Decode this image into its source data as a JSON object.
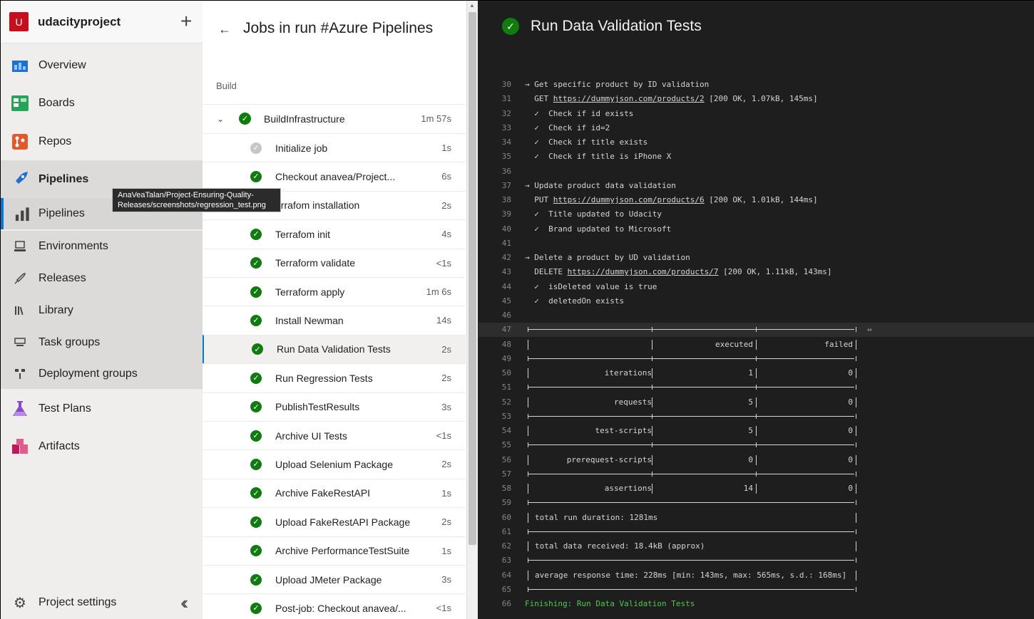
{
  "nav": {
    "org_initial": "U",
    "org_name": "udacityproject",
    "items": [
      {
        "label": "Overview"
      },
      {
        "label": "Boards"
      },
      {
        "label": "Repos"
      },
      {
        "label": "Pipelines"
      },
      {
        "label": "Pipelines"
      },
      {
        "label": "Environments"
      },
      {
        "label": "Releases"
      },
      {
        "label": "Library"
      },
      {
        "label": "Task groups"
      },
      {
        "label": "Deployment groups"
      },
      {
        "label": "Test Plans"
      },
      {
        "label": "Artifacts"
      }
    ],
    "project_settings": "Project settings",
    "tooltip_line1": "AnaVeaTalan/Project-Ensuring-Quality-",
    "tooltip_line2": "Releases/screenshots/regression_test.png"
  },
  "jobs": {
    "title": "Jobs in run #Azure Pipelines",
    "stage": "Build",
    "parent": {
      "name": "BuildInfrastructure",
      "duration": "1m 57s"
    },
    "rows": [
      {
        "name": "Initialize job",
        "duration": "1s"
      },
      {
        "name": "Checkout anavea/Project...",
        "duration": "6s"
      },
      {
        "name": "errafom installation",
        "duration": "2s"
      },
      {
        "name": "Terrafom init",
        "duration": "4s"
      },
      {
        "name": "Terraform validate",
        "duration": "<1s"
      },
      {
        "name": "Terraform apply",
        "duration": "1m 6s"
      },
      {
        "name": "Install Newman",
        "duration": "14s"
      },
      {
        "name": "Run Data Validation Tests",
        "duration": "2s"
      },
      {
        "name": "Run Regression Tests",
        "duration": "2s"
      },
      {
        "name": "PublishTestResults",
        "duration": "3s"
      },
      {
        "name": "Archive UI Tests",
        "duration": "<1s"
      },
      {
        "name": "Upload Selenium Package",
        "duration": "2s"
      },
      {
        "name": "Archive FakeRestAPI",
        "duration": "1s"
      },
      {
        "name": "Upload FakeRestAPI Package",
        "duration": "2s"
      },
      {
        "name": "Archive PerformanceTestSuite",
        "duration": "1s"
      },
      {
        "name": "Upload JMeter Package",
        "duration": "3s"
      },
      {
        "name": "Post-job: Checkout  anavea/...",
        "duration": "<1s"
      }
    ]
  },
  "log": {
    "title": "Run Data Validation Tests",
    "lines": [
      {
        "n": "30",
        "t": "→ Get specific product by ID validation"
      },
      {
        "n": "31",
        "t": "  GET ",
        "link": "https://dummyjson.com/products/2",
        "after": " [200 OK, 1.07kB, 145ms]"
      },
      {
        "n": "32",
        "t": "  ✓  Check if id exists"
      },
      {
        "n": "33",
        "t": "  ✓  Check if id=2"
      },
      {
        "n": "34",
        "t": "  ✓  Check if title exists"
      },
      {
        "n": "35",
        "t": "  ✓  Check if title is iPhone X"
      },
      {
        "n": "36",
        "t": ""
      },
      {
        "n": "37",
        "t": "→ Update product data validation"
      },
      {
        "n": "38",
        "t": "  PUT ",
        "link": "https://dummyjson.com/products/6",
        "after": " [200 OK, 1.01kB, 144ms]"
      },
      {
        "n": "39",
        "t": "  ✓  Title updated to Udacity"
      },
      {
        "n": "40",
        "t": "  ✓  Brand updated to Microsoft"
      },
      {
        "n": "41",
        "t": ""
      },
      {
        "n": "42",
        "t": "→ Delete a product by UD validation"
      },
      {
        "n": "43",
        "t": "  DELETE ",
        "link": "https://dummyjson.com/products/7",
        "after": " [200 OK, 1.11kB, 143ms]"
      },
      {
        "n": "44",
        "t": "  ✓  isDeleted value is true"
      },
      {
        "n": "45",
        "t": "  ✓  deletedOn exists"
      },
      {
        "n": "46",
        "t": ""
      }
    ],
    "table_line_numbers": [
      "47",
      "48",
      "49",
      "50",
      "51",
      "52",
      "53",
      "54",
      "55",
      "56",
      "57",
      "58",
      "59",
      "60",
      "61",
      "62",
      "63",
      "64",
      "65",
      "66"
    ],
    "table": {
      "header": [
        "",
        "executed",
        "failed"
      ],
      "rows": [
        [
          "iterations",
          "1",
          "0"
        ],
        [
          "requests",
          "5",
          "0"
        ],
        [
          "test-scripts",
          "5",
          "0"
        ],
        [
          "prerequest-scripts",
          "0",
          "0"
        ],
        [
          "assertions",
          "14",
          "0"
        ]
      ],
      "duration": "total run duration: 1281ms",
      "received": "total data received: 18.4kB (approx)",
      "response": "average response time: 228ms [min: 143ms, max: 565ms, s.d.: 168ms]"
    },
    "finishing": "Finishing: Run Data Validation Tests"
  }
}
